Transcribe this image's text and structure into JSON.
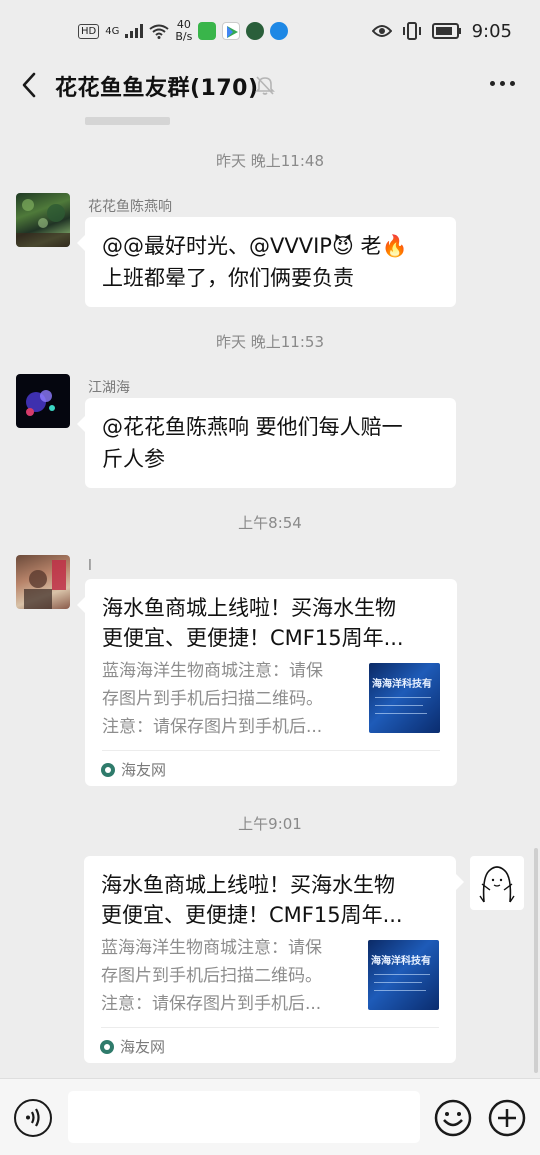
{
  "status_bar": {
    "network_label": "HD",
    "signal_label": "4G",
    "speed_value": "40",
    "speed_unit": "B/s",
    "time": "9:05"
  },
  "nav": {
    "title": "花花鱼鱼友群(170)"
  },
  "messages": [
    {
      "timestamp": "昨天 晚上11:48",
      "sender": "花花鱼陈燕响",
      "text_line1": "@@最好时光、@VVVIP😈 老🔥",
      "text_line2": "上班都晕了，你们俩要负责"
    },
    {
      "timestamp": "昨天 晚上11:53",
      "sender": "江湖海",
      "text_line1": "@花花鱼陈燕响  要他们每人赔一",
      "text_line2": "斤人参"
    },
    {
      "timestamp": "上午8:54",
      "sender": "l",
      "card": {
        "title_line1": "海水鱼商城上线啦！买海水生物",
        "title_line2": "更便宜、更便捷！CMF15周年...",
        "desc_line1": "蓝海海洋生物商城注意：请保",
        "desc_line2": "存图片到手机后扫描二维码。",
        "desc_line3": "注意：请保存图片到手机后...",
        "thumb_text": "海海洋科技有",
        "source": "海友网"
      }
    },
    {
      "timestamp": "上午9:01",
      "card": {
        "title_line1": "海水鱼商城上线啦！买海水生物",
        "title_line2": "更便宜、更便捷！CMF15周年...",
        "desc_line1": "蓝海海洋生物商城注意：请保",
        "desc_line2": "存图片到手机后扫描二维码。",
        "desc_line3": "注意：请保存图片到手机后...",
        "thumb_text": "海海洋科技有",
        "source": "海友网"
      }
    }
  ],
  "colors": {
    "background": "#ededed",
    "bubble": "#ffffff",
    "timestamp": "#8a8a8a",
    "source_icon": "#2f7b6b"
  },
  "icons": {
    "back": "chevron-left-icon",
    "mute": "bell-off-icon",
    "more": "more-dots-icon",
    "voice": "voice-icon",
    "emoji": "emoji-icon",
    "plus": "plus-icon"
  }
}
